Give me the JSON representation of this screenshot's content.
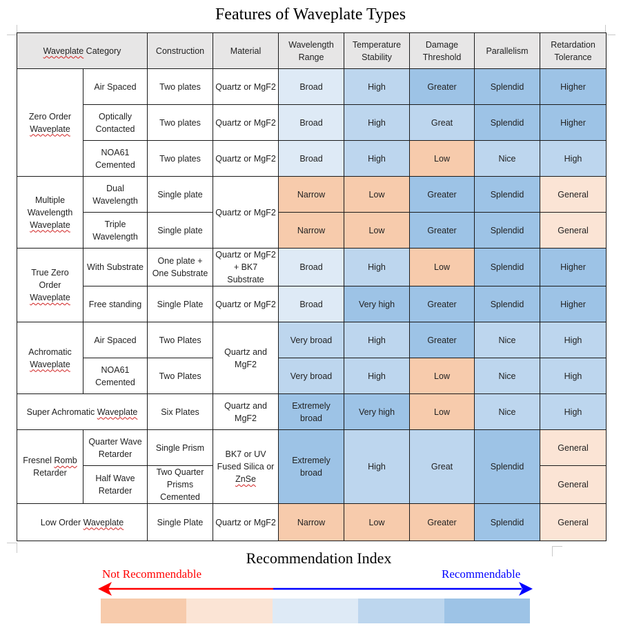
{
  "title": "Features of Waveplate Types",
  "header": {
    "category": "Waveplate Category",
    "category_squiggle": "Waveplate",
    "category_rest": " Category",
    "construction": "Construction",
    "material": "Material",
    "wavelength_range": "Wavelength Range",
    "temperature_stability": "Temperature Stability",
    "damage_threshold": "Damage Threshold",
    "parallelism": "Parallelism",
    "retardation_tolerance": "Retardation Tolerance"
  },
  "groups": {
    "zero_order": {
      "name_line1": "Zero Order",
      "name_line2": "Waveplate",
      "rows": [
        {
          "sub": "Air Spaced",
          "construction": "Two plates",
          "material": "Quartz or MgF2",
          "wavelength": "Broad",
          "temperature": "High",
          "damage": "Greater",
          "parallelism": "Splendid",
          "retardation": "Higher"
        },
        {
          "sub": "Optically Contacted",
          "construction": "Two plates",
          "material": "Quartz or MgF2",
          "wavelength": "Broad",
          "temperature": "High",
          "damage": "Great",
          "parallelism": "Splendid",
          "retardation": "Higher"
        },
        {
          "sub": "NOA61 Cemented",
          "construction": "Two plates",
          "material": "Quartz or MgF2",
          "wavelength": "Broad",
          "temperature": "High",
          "damage": "Low",
          "parallelism": "Nice",
          "retardation": "High"
        }
      ]
    },
    "multiple_wavelength": {
      "name_line1": "Multiple",
      "name_line2": "Wavelength",
      "name_line3": "Waveplate",
      "material": "Quartz or MgF2",
      "rows": [
        {
          "sub": "Dual Wavelength",
          "construction": "Single plate",
          "wavelength": "Narrow",
          "temperature": "Low",
          "damage": "Greater",
          "parallelism": "Splendid",
          "retardation": "General"
        },
        {
          "sub": "Triple Wavelength",
          "construction": "Single plate",
          "wavelength": "Narrow",
          "temperature": "Low",
          "damage": "Greater",
          "parallelism": "Splendid",
          "retardation": "General"
        }
      ]
    },
    "true_zero_order": {
      "name_line1": "True Zero",
      "name_line2": "Order",
      "name_line3": "Waveplate",
      "rows": [
        {
          "sub": "With Substrate",
          "construction": "One plate + One Substrate",
          "material": "Quartz or MgF2 + BK7 Substrate",
          "wavelength": "Broad",
          "temperature": "High",
          "damage": "Low",
          "parallelism": "Splendid",
          "retardation": "Higher"
        },
        {
          "sub": "Free standing",
          "construction": "Single Plate",
          "material": "Quartz or MgF2",
          "wavelength": "Broad",
          "temperature": "Very high",
          "damage": "Greater",
          "parallelism": "Splendid",
          "retardation": "Higher"
        }
      ]
    },
    "achromatic": {
      "name_line1": "Achromatic",
      "name_line2": "Waveplate",
      "material": "Quartz and MgF2",
      "rows": [
        {
          "sub": "Air Spaced",
          "construction": "Two Plates",
          "wavelength": "Very broad",
          "temperature": "High",
          "damage": "Greater",
          "parallelism": "Nice",
          "retardation": "High"
        },
        {
          "sub": "NOA61 Cemented",
          "construction": "Two Plates",
          "wavelength": "Very broad",
          "temperature": "High",
          "damage": "Low",
          "parallelism": "Nice",
          "retardation": "High"
        }
      ]
    },
    "super_achromatic": {
      "name_prefix": "Super Achromatic ",
      "name_squiggle": "Waveplate",
      "construction": "Six Plates",
      "material": "Quartz and MgF2",
      "wavelength": "Extremely broad",
      "temperature": "Very high",
      "damage": "Low",
      "parallelism": "Nice",
      "retardation": "High"
    },
    "fresnel_rhomb": {
      "name_prefix": "Fresnel ",
      "name_squiggle": "Romb",
      "name_line2": "Retarder",
      "material_line1": "BK7 or UV Fused Silica or",
      "material_squiggle": "ZnSe",
      "wavelength": "Extremely broad",
      "temperature": "High",
      "damage": "Great",
      "parallelism": "Splendid",
      "rows": [
        {
          "sub": "Quarter Wave Retarder",
          "construction": "Single Prism",
          "retardation": "General"
        },
        {
          "sub": "Half Wave Retarder",
          "construction": "Two Quarter Prisms Cemented",
          "retardation": "General"
        }
      ]
    },
    "low_order": {
      "name_prefix": "Low Order ",
      "name_squiggle": "Waveplate",
      "construction": "Single Plate",
      "material": "Quartz or MgF2",
      "wavelength": "Narrow",
      "temperature": "Low",
      "damage": "Greater",
      "parallelism": "Splendid",
      "retardation": "General"
    }
  },
  "legend": {
    "title": "Recommendation Index",
    "left_label": "Not Recommendable",
    "right_label": "Recommendable",
    "left_color": "#FF0000",
    "right_color": "#0000FF",
    "levels": [
      {
        "level": 1,
        "color": "#F7CBAC"
      },
      {
        "level": 2,
        "color": "#FBE4D5"
      },
      {
        "level": 3,
        "color": "#DEEAF6"
      },
      {
        "level": 4,
        "color": "#BDD6EE"
      },
      {
        "level": 5,
        "color": "#9DC3E6"
      }
    ]
  },
  "colors": {
    "header_background": "#E7E6E6",
    "border": "#1A1A1A"
  }
}
